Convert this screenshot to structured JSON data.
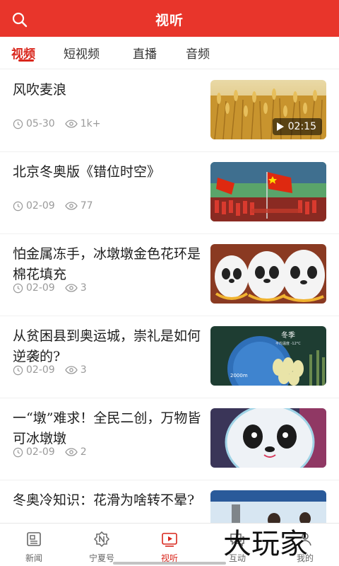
{
  "header": {
    "title": "视听"
  },
  "tabs": [
    {
      "label": "视频"
    },
    {
      "label": "短视频"
    },
    {
      "label": "直播"
    },
    {
      "label": "音频"
    }
  ],
  "items": [
    {
      "title": "风吹麦浪",
      "date": "05-30",
      "views": "1k+",
      "duration": "02:15"
    },
    {
      "title": "北京冬奥版《错位时空》",
      "date": "02-09",
      "views": "77"
    },
    {
      "title": "怕金属冻手，冰墩墩金色花环是棉花填充",
      "date": "02-09",
      "views": "3"
    },
    {
      "title": "从贫困县到奥运城，崇礼是如何逆袭的?",
      "date": "02-09",
      "views": "3"
    },
    {
      "title": "一“墩”难求！全民二创，万物皆可冰墩墩",
      "date": "02-09",
      "views": "2"
    },
    {
      "title": "冬奥冷知识：花滑为啥转不晕?",
      "date": "",
      "views": ""
    }
  ],
  "thumb_text": {
    "season": "冬季",
    "season_sub": "平均温度 -12°C",
    "year": "2000m"
  },
  "bottom_nav": [
    {
      "label": "新闻",
      "icon": "news-icon"
    },
    {
      "label": "宁夏号",
      "icon": "ningxia-icon"
    },
    {
      "label": "视听",
      "icon": "video-icon"
    },
    {
      "label": "互动",
      "icon": "interact-icon"
    },
    {
      "label": "我的",
      "icon": "profile-icon"
    }
  ],
  "watermark": "大玩家",
  "colors": {
    "brand_red": "#e8352b",
    "active_red": "#d9261c",
    "meta_gray": "#9a9a9a"
  }
}
